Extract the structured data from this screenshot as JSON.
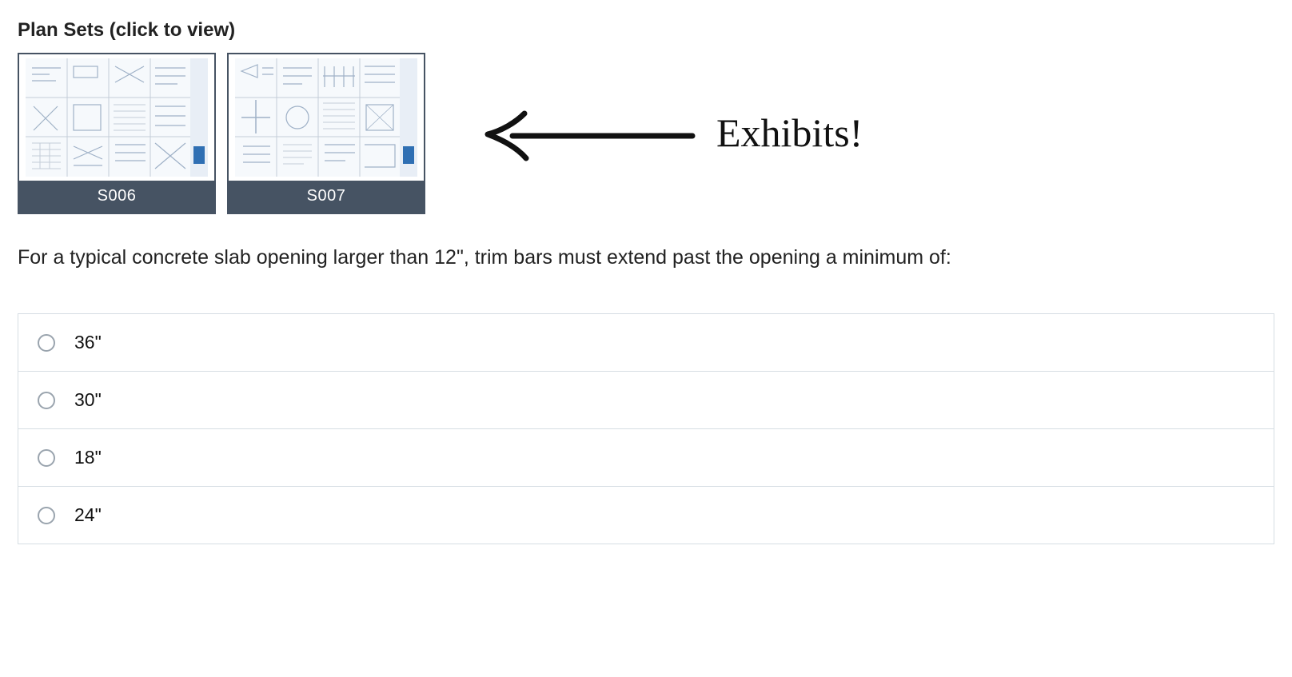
{
  "plan_sets_heading": "Plan Sets (click to view)",
  "plan_cards": [
    {
      "label": "S006"
    },
    {
      "label": "S007"
    }
  ],
  "annotation_label": "Exhibits!",
  "question_text": "For a typical concrete slab opening larger than 12\", trim bars must extend past the opening a minimum of:",
  "options": [
    {
      "label": "36\""
    },
    {
      "label": "30\""
    },
    {
      "label": "18\""
    },
    {
      "label": "24\""
    }
  ]
}
